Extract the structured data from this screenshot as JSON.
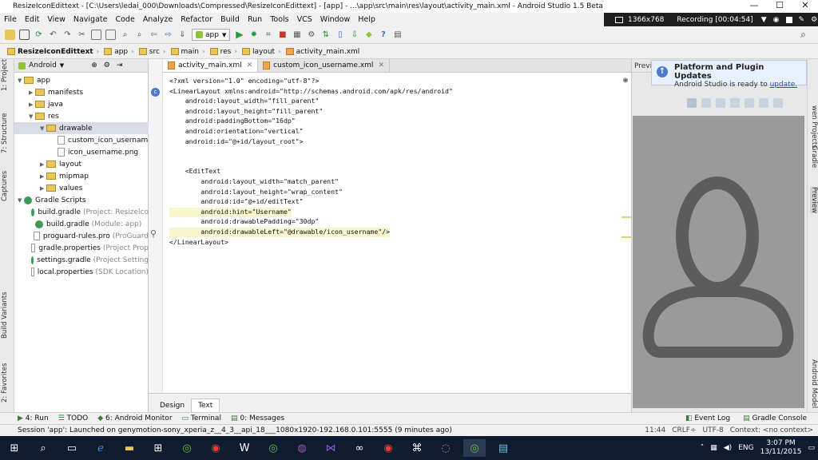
{
  "window": {
    "title": "ResizeIconEdittext - [C:\\Users\\ledai_000\\Downloads\\Compressed\\ResizeIconEdittext] - [app] - ...\\app\\src\\main\\res\\layout\\activity_main.xml - Android Studio 1.5 Beta",
    "minimize": "—",
    "maximize": "☐",
    "close": "✕"
  },
  "menu": [
    "File",
    "Edit",
    "View",
    "Navigate",
    "Code",
    "Analyze",
    "Refactor",
    "Build",
    "Run",
    "Tools",
    "VCS",
    "Window",
    "Help"
  ],
  "recorder": {
    "resolution": "1366x768",
    "status": "Recording [00:04:54]"
  },
  "toolbar": {
    "run_config": "app"
  },
  "breadcrumbs": [
    "ResizeIconEdittext",
    "app",
    "src",
    "main",
    "res",
    "layout",
    "activity_main.xml"
  ],
  "left_strip": {
    "project": "1: Project",
    "structure": "7: Structure",
    "captures": "Captures",
    "build_variants": "Build Variants",
    "favorites": "2: Favorites"
  },
  "project_panel": {
    "view": "Android",
    "items": [
      {
        "label": "app",
        "indent": 0,
        "type": "folder",
        "arrow": "▼"
      },
      {
        "label": "manifests",
        "indent": 1,
        "type": "folder",
        "arrow": "▶"
      },
      {
        "label": "java",
        "indent": 1,
        "type": "folder",
        "arrow": "▶"
      },
      {
        "label": "res",
        "indent": 1,
        "type": "folder",
        "arrow": "▼"
      },
      {
        "label": "drawable",
        "indent": 2,
        "type": "folder",
        "arrow": "▼"
      },
      {
        "label": "custom_icon_usernam",
        "indent": 3,
        "type": "file",
        "arrow": ""
      },
      {
        "label": "icon_username.png",
        "indent": 3,
        "type": "file",
        "arrow": ""
      },
      {
        "label": "layout",
        "indent": 2,
        "type": "folder",
        "arrow": "▶"
      },
      {
        "label": "mipmap",
        "indent": 2,
        "type": "folder",
        "arrow": "▶"
      },
      {
        "label": "values",
        "indent": 2,
        "type": "folder",
        "arrow": "▶"
      },
      {
        "label": "Gradle Scripts",
        "indent": 0,
        "type": "gradle",
        "arrow": "▼"
      },
      {
        "label": "build.gradle",
        "muted": "(Project: Resizelco",
        "indent": 1,
        "type": "gradle",
        "arrow": ""
      },
      {
        "label": "build.gradle",
        "muted": "(Module: app)",
        "indent": 1,
        "type": "gradle",
        "arrow": ""
      },
      {
        "label": "proguard-rules.pro",
        "muted": "(ProGuard",
        "indent": 1,
        "type": "file",
        "arrow": ""
      },
      {
        "label": "gradle.properties",
        "muted": "(Project Prop",
        "indent": 1,
        "type": "file",
        "arrow": ""
      },
      {
        "label": "settings.gradle",
        "muted": "(Project Setting",
        "indent": 1,
        "type": "gradle",
        "arrow": ""
      },
      {
        "label": "local.properties",
        "muted": "(SDK Location)",
        "indent": 1,
        "type": "file",
        "arrow": ""
      }
    ]
  },
  "editor_tabs": [
    {
      "label": "activity_main.xml",
      "active": true
    },
    {
      "label": "custom_icon_username.xml",
      "active": false
    }
  ],
  "code": [
    {
      "t": "<?xml version=\"1.0\" encoding=\"utf-8\"?>"
    },
    {
      "t": "<LinearLayout xmlns:android=\"http://schemas.android.com/apk/res/android\""
    },
    {
      "t": "    android:layout_width=\"fill_parent\""
    },
    {
      "t": "    android:layout_height=\"fill_parent\""
    },
    {
      "t": "    android:paddingBottom=\"16dp\""
    },
    {
      "t": "    android:orientation=\"vertical\""
    },
    {
      "t": "    android:id=\"@+id/layout_root\">"
    },
    {
      "t": ""
    },
    {
      "t": ""
    },
    {
      "t": "    <EditText"
    },
    {
      "t": "        android:layout_width=\"match_parent\""
    },
    {
      "t": "        android:layout_height=\"wrap_content\""
    },
    {
      "t": "        android:id=\"@+id/editText\""
    },
    {
      "t": "        android:hint=\"Username\"",
      "hl": true
    },
    {
      "t": "        android:drawablePadding=\"30dp\""
    },
    {
      "t": "        android:drawableLeft=\"@drawable/icon_username\"/>",
      "hl": true
    },
    {
      "t": "</LinearLayout>"
    }
  ],
  "bottom_tabs": [
    {
      "label": "Design",
      "active": false
    },
    {
      "label": "Text",
      "active": true
    }
  ],
  "preview": {
    "label": "Previe"
  },
  "notification": {
    "title": "Platform and Plugin Updates",
    "body": "Android Studio is ready to ",
    "link": "update."
  },
  "right_strip": {
    "preview_strip": "Preview",
    "gradle": "Gradle",
    "projects": "wen Projects",
    "android_model": "Android Model"
  },
  "tool_windows": [
    {
      "label": "4: Run",
      "icon": "▶"
    },
    {
      "label": "TODO",
      "icon": "☰"
    },
    {
      "label": "6: Android Monitor",
      "icon": "◆"
    },
    {
      "label": "Terminal",
      "icon": "▭"
    },
    {
      "label": "0: Messages",
      "icon": "▤"
    }
  ],
  "tool_windows_right": [
    {
      "label": "Event Log",
      "icon": "◧"
    },
    {
      "label": "Gradle Console",
      "icon": "▤"
    }
  ],
  "status": {
    "message": "Session 'app': Launched on genymotion-sony_xperia_z__4_3__api_18___1080x1920-192.168.0.101:5555 (9 minutes ago)",
    "position": "11:44",
    "line_sep": "CRLF÷",
    "encoding": "UTF-8",
    "context": "Context: <no context>"
  },
  "taskbar": {
    "lang": "ENG",
    "time": "3:07 PM",
    "date": "13/11/2015"
  }
}
